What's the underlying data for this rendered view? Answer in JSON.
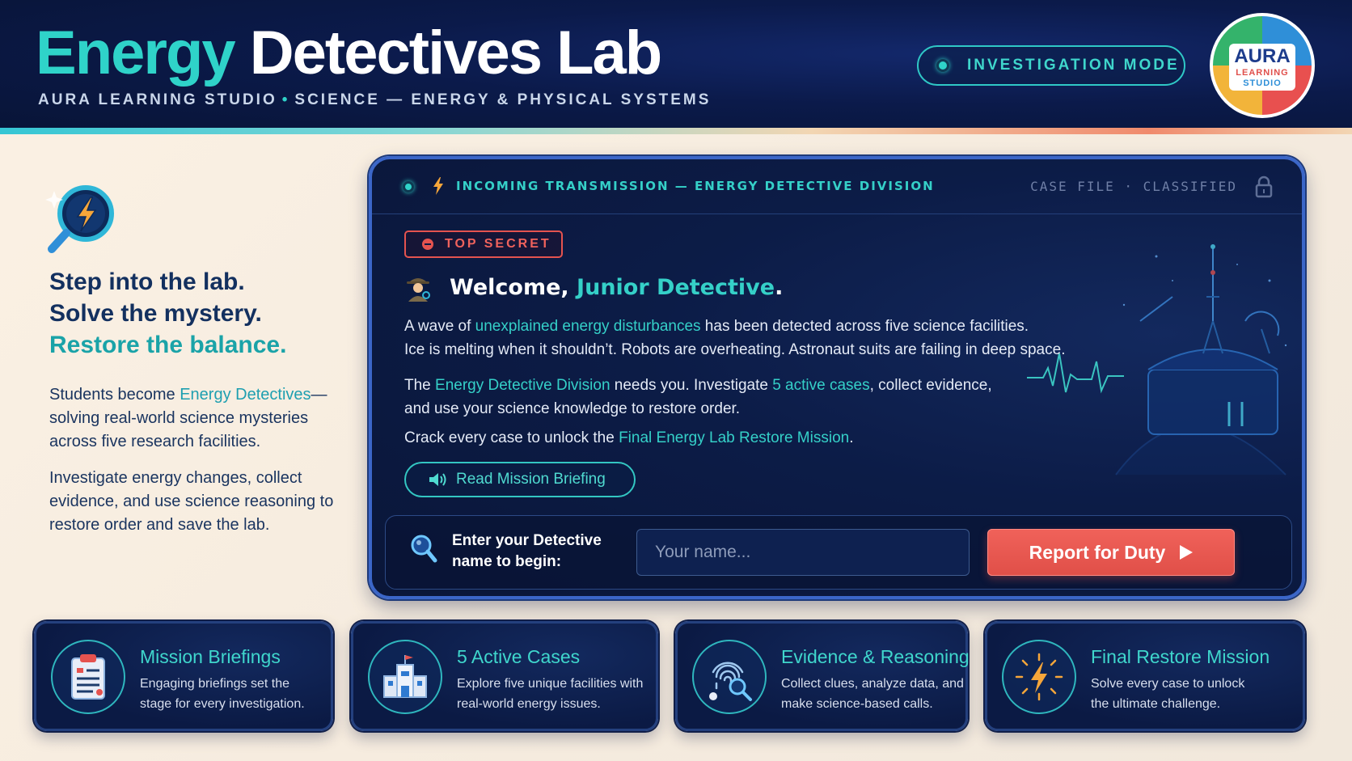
{
  "header": {
    "title_accent": "Energy",
    "title_rest": " Detectives Lab",
    "subtitle_left": "AURA LEARNING STUDIO",
    "subtitle_sep": "•",
    "subtitle_right": "SCIENCE — ENERGY & PHYSICAL SYSTEMS",
    "mode_label": "INVESTIGATION MODE",
    "logo": {
      "line1": "AURA",
      "line2": "LEARNING",
      "line3": "STUDIO"
    }
  },
  "left": {
    "tagline_1": "Step into the lab.",
    "tagline_2": "Solve the mystery.",
    "tagline_3": "Restore the balance.",
    "p1_a": "Students become ",
    "p1_hl": "Energy Detectives",
    "p1_b": "—solving real-world science mysteries across five research facilities.",
    "p2": "Investigate energy changes, collect evidence, and use science reasoning to restore order and save the lab."
  },
  "panel": {
    "transmission_label": "INCOMING TRANSMISSION — ENERGY DETECTIVE DIVISION",
    "case_label": "CASE FILE · CLASSIFIED",
    "badge": "TOP SECRET",
    "welcome_a": "Welcome, ",
    "welcome_name": "Junior Detective",
    "welcome_b": ".",
    "para1_a": "A wave of ",
    "para1_hl": "unexplained energy disturbances",
    "para1_b": " has been detected across five science facilities.",
    "para1_line2": "Ice is melting when it shouldn’t. Robots are overheating. Astronaut suits are failing in deep space.",
    "para2_a": "The ",
    "para2_hl1": "Energy Detective Division",
    "para2_b": " needs you. Investigate ",
    "para2_hl2": "5 active cases",
    "para2_c": ", collect evidence,",
    "para2_line2": "and use your science knowledge to restore order.",
    "para3_a": "Crack every case to unlock the ",
    "para3_hl": "Final Energy Lab Restore Mission",
    "para3_b": ".",
    "briefing_button": "Read Mission Briefing",
    "name_prompt": "Enter your Detective name to begin:",
    "name_placeholder": "Your name...",
    "name_value": "",
    "report_button": "Report for Duty"
  },
  "cards": [
    {
      "title": "Mission Briefings",
      "desc": "Engaging briefings set the stage for every investigation.",
      "icon": "clipboard-icon"
    },
    {
      "title": "5 Active Cases",
      "desc": "Explore five unique facilities with real-world energy issues.",
      "icon": "facility-icon"
    },
    {
      "title": "Evidence & Reasoning",
      "desc": "Collect clues, analyze data, and make science-based calls.",
      "icon": "fingerprint-icon"
    },
    {
      "title": "Final Restore Mission",
      "desc": "Solve every case to unlock the ultimate challenge.",
      "icon": "lightning-icon"
    }
  ],
  "colors": {
    "accent_teal": "#35d0c8",
    "navy": "#0b1a44",
    "alert_red": "#e5534f"
  }
}
